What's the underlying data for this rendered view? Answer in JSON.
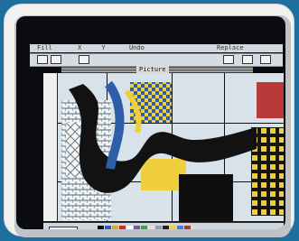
{
  "menubar": {
    "items": [
      "Fill",
      "X",
      "Y",
      "Undo",
      "Replace"
    ]
  },
  "window": {
    "title": "Picture"
  },
  "tools": [
    "paint-bucket",
    "brush",
    "pencil",
    "eraser",
    "scissors",
    "hand"
  ],
  "palette": {
    "colors": [
      "#0a0a0a",
      "#2d5da8",
      "#d5af2c",
      "#c4302b",
      "#ffffff",
      "#7b55a6",
      "#41a04f",
      "#e0e0e0",
      "#9aa1a6",
      "#232323",
      "#f2d241",
      "#4a82c9",
      "#a63c3c",
      "#d8d8d8"
    ]
  }
}
